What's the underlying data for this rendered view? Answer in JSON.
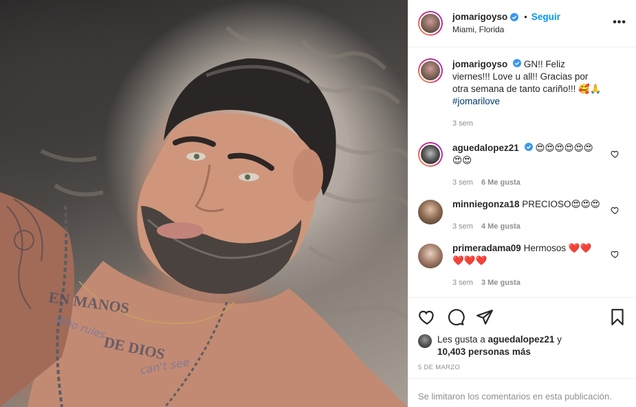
{
  "header": {
    "username": "jomarigoyso",
    "separator": "•",
    "follow_label": "Seguir",
    "location": "Miami, Florida",
    "more_label": "•••"
  },
  "caption": {
    "username": "jomarigoyso",
    "text": "GN!! Feliz viernes!!! Love u all!! Gracias por otra semana de tanto cariño!!! 🥰🙏",
    "hashtag": "#jomarilove",
    "time": "3 sem"
  },
  "comments": [
    {
      "username": "aguedalopez21",
      "text": "😍😍😍😍😍😍😍😍",
      "time": "3 sem",
      "likes": "6 Me gusta"
    },
    {
      "username": "minniegonza18",
      "text": "PRECIOSO😍😍😍",
      "time": "3 sem",
      "likes": "4 Me gusta"
    },
    {
      "username": "primeradama09",
      "text": "Hermosos ❤️❤️❤️❤️❤️",
      "time": "3 sem",
      "likes": "3 Me gusta"
    }
  ],
  "likes": {
    "prefix": "Les gusta a",
    "user": "aguedalopez21",
    "conjunction": "y",
    "others": "10,403 personas más"
  },
  "date": "5 DE MARZO",
  "comments_limited": "Se limitaron los comentarios en esta publicación.",
  "photo": {
    "tattoo_line1": "EN MANOS",
    "tattoo_line2": "DE DIOS",
    "tattoo_line3": "Who rules",
    "tattoo_line4": "can't see"
  },
  "colors": {
    "accent": "#0095f6",
    "verified": "#3897f0",
    "muted": "#8e8e8e",
    "text": "#262626"
  }
}
